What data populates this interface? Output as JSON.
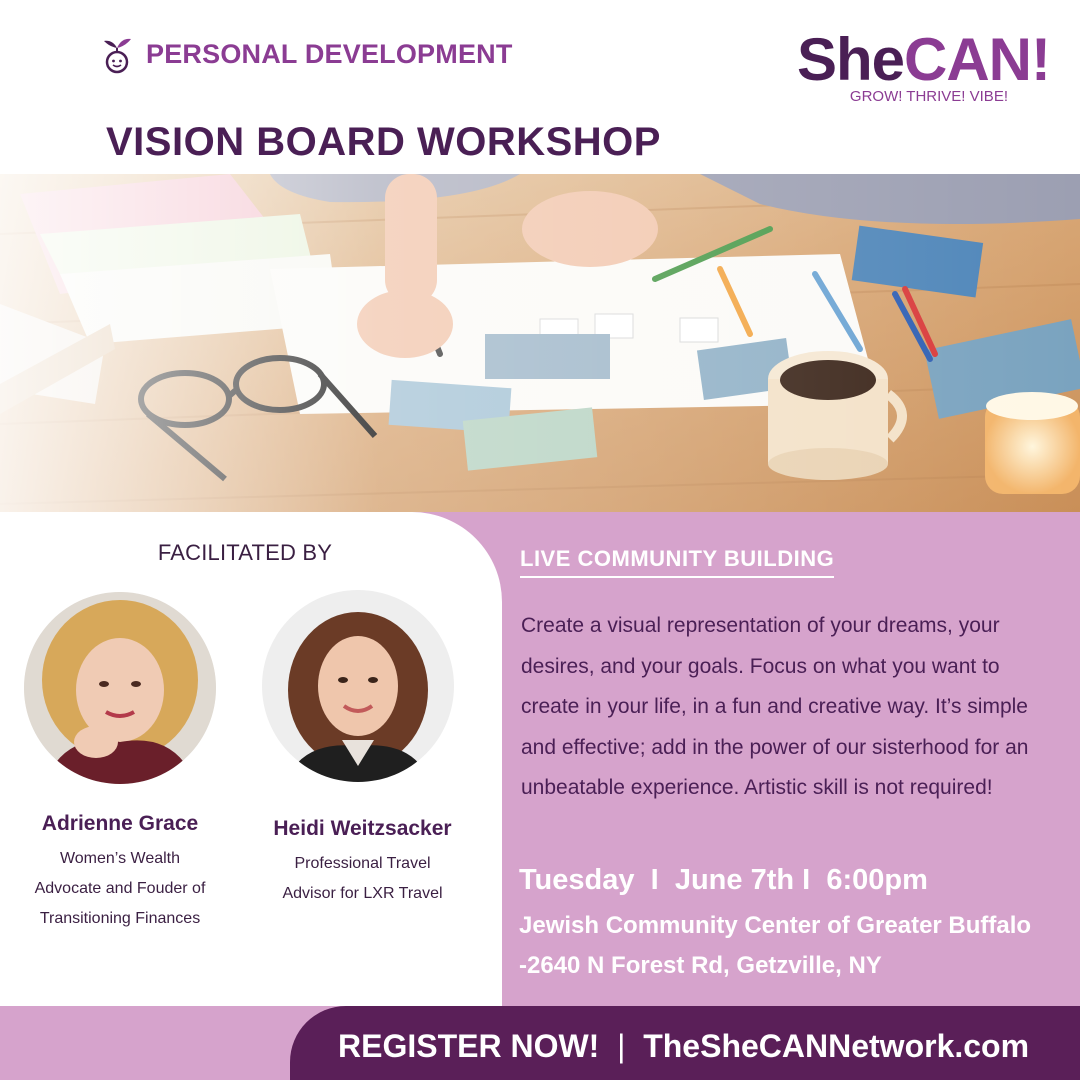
{
  "header": {
    "category": "PERSONAL DEVELOPMENT",
    "title": "VISION BOARD WORKSHOP"
  },
  "logo": {
    "she": "She",
    "can": "CAN!",
    "tagline": "GROW! THRIVE! VIBE!"
  },
  "facilitators": {
    "title": "FACILITATED BY",
    "people": [
      {
        "name": "Adrienne Grace",
        "role_lines": [
          "Women’s Wealth",
          "Advocate and Fouder of",
          "Transitioning Finances"
        ]
      },
      {
        "name": "Heidi Weitzsacker",
        "role_lines": [
          "Professional Travel",
          "Advisor for LXR Travel"
        ]
      }
    ]
  },
  "details": {
    "section_title": "LIVE COMMUNITY BUILDING",
    "description": "Create a visual representation of your dreams, your desires, and your goals. Focus on what you want to create in your life, in a fun and creative way.  It’s simple and effective;  add in the power of our sisterhood for an unbeatable experience. Artistic skill is not required!",
    "day": "Tuesday",
    "date": "June 7th",
    "time": "6:00pm",
    "separator": "I",
    "location": "Jewish Community Center of Greater Buffalo -2640 N Forest Rd, Getzville, NY"
  },
  "footer": {
    "register": "REGISTER NOW!",
    "separator": "|",
    "website": "TheSheCANNetwork.com"
  },
  "colors": {
    "brand_dark": "#4a1f55",
    "brand_purple": "#8b3c93",
    "panel_lilac": "#d6a3cc",
    "footer_plum": "#5a1f58"
  }
}
